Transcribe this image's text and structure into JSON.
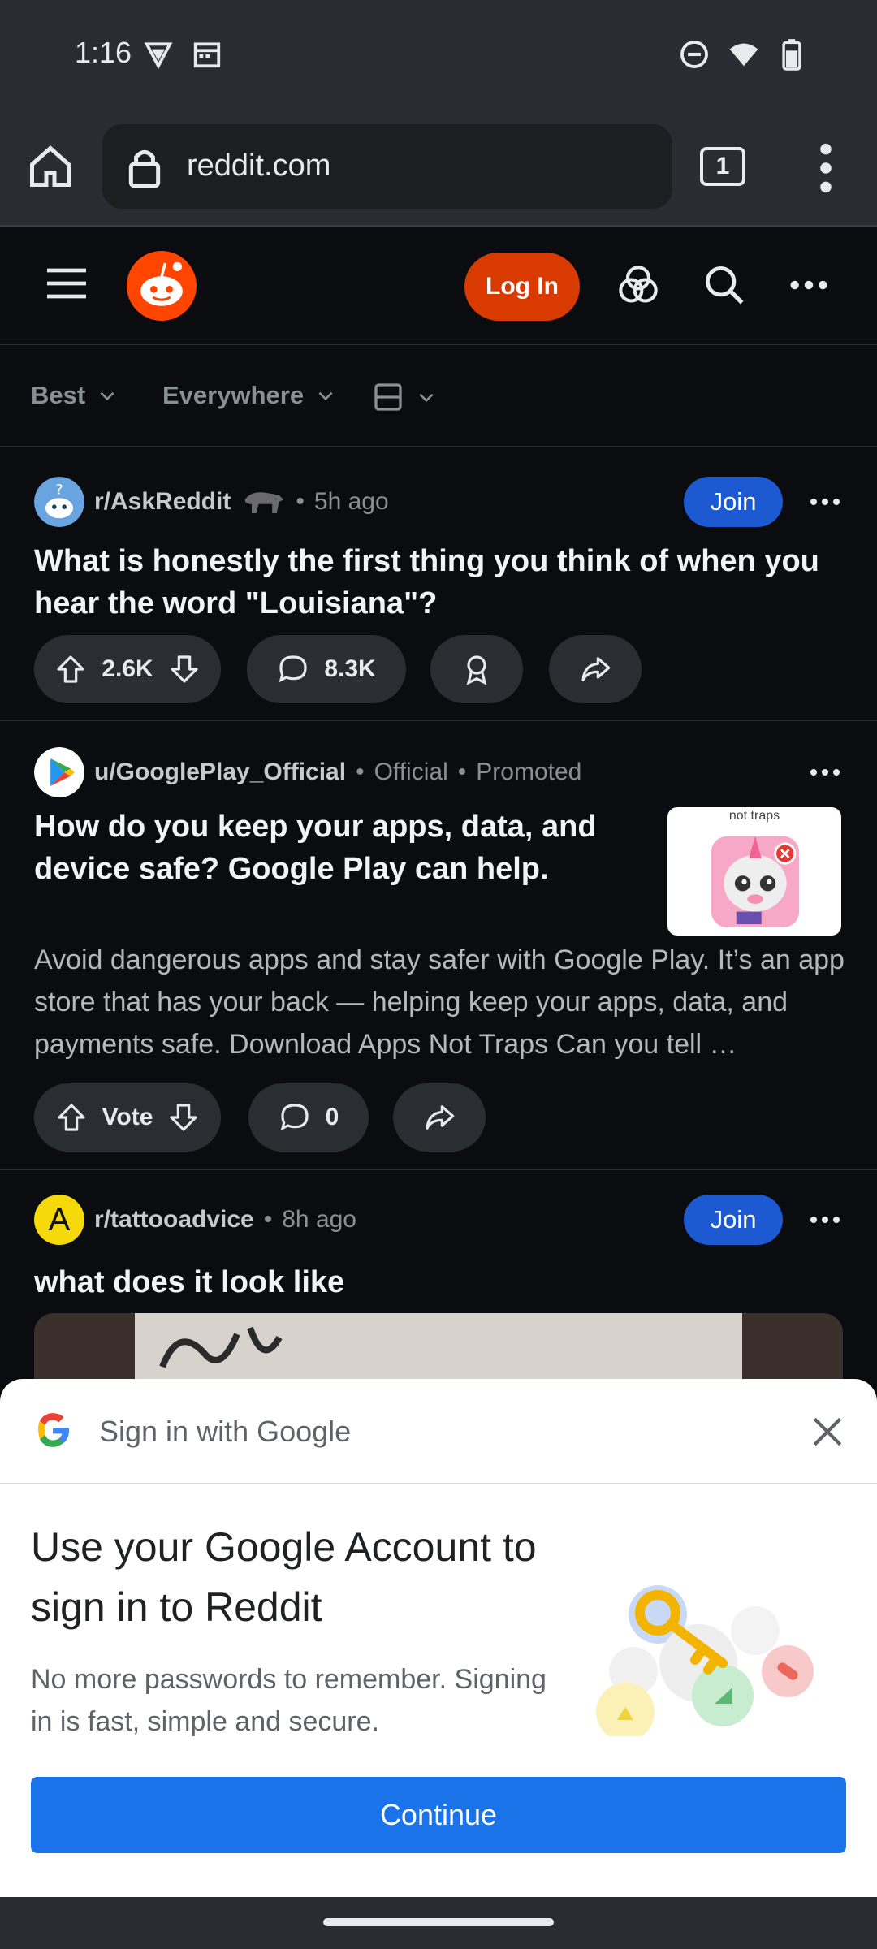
{
  "status_bar": {
    "time": "1:16"
  },
  "browser": {
    "url": "reddit.com",
    "tab_count": "1"
  },
  "reddit_header": {
    "login_label": "Log In"
  },
  "sort_bar": {
    "sort": "Best",
    "location": "Everywhere"
  },
  "posts": [
    {
      "subreddit": "r/AskReddit",
      "time": "5h ago",
      "join_label": "Join",
      "title": "What is honestly the first thing you think of when you hear the word \"Louisiana\"?",
      "votes": "2.6K",
      "comments": "8.3K"
    },
    {
      "user": "u/GooglePlay_Official",
      "official": "Official",
      "promoted": "Promoted",
      "title": "How do you keep your apps, data, and device safe? Google Play can help.",
      "body": "Avoid dangerous apps and stay safer with Google Play. It’s an app store that has your back — helping keep your apps, data, and payments safe. Download Apps Not Traps Can you tell …",
      "thumb_text": "not traps",
      "votes": "Vote",
      "comments": "0"
    },
    {
      "subreddit": "r/tattooadvice",
      "avatar_letter": "A",
      "time": "8h ago",
      "join_label": "Join",
      "title": "what does it look like"
    }
  ],
  "google_sheet": {
    "header": "Sign in with Google",
    "title": "Use your Google Account to sign in to Reddit",
    "description": "No more passwords to remember. Signing in is fast, simple and secure.",
    "continue_label": "Continue"
  },
  "colors": {
    "reddit_orange": "#d93a00",
    "join_blue": "#1d59d1",
    "google_blue": "#1a73e8"
  }
}
